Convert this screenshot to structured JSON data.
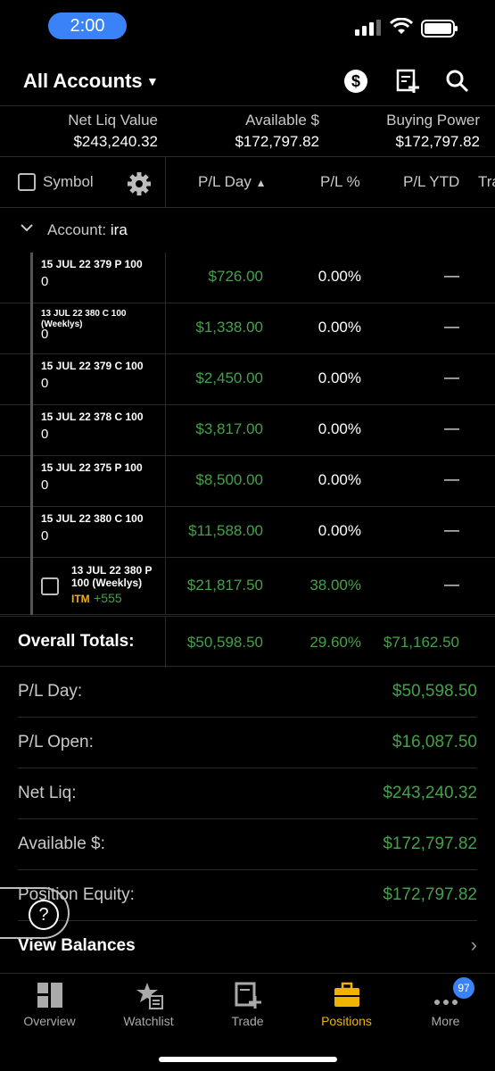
{
  "status_bar": {
    "time": "2:00"
  },
  "header": {
    "title": "All Accounts"
  },
  "summary": [
    {
      "label": "Net Liq Value",
      "value": "$243,240.32"
    },
    {
      "label": "Available $",
      "value": "$172,797.82"
    },
    {
      "label": "Buying Power",
      "value": "$172,797.82"
    }
  ],
  "columns": {
    "symbol": "Symbol",
    "pl_day": "P/L Day",
    "pl_pct": "P/L %",
    "pl_ytd": "P/L YTD",
    "trade_cut": "Tra"
  },
  "account_group": {
    "label": "Account:",
    "name": "ira"
  },
  "rows": [
    {
      "symbol": "15 JUL 22 379 P 100",
      "qty": "0",
      "pl_day": "$726.00",
      "pl_pct": "0.00%",
      "pl_ytd": "—"
    },
    {
      "symbol": "13 JUL 22 380 C 100 (Weeklys)",
      "qty": "0",
      "pl_day": "$1,338.00",
      "pl_pct": "0.00%",
      "pl_ytd": "—"
    },
    {
      "symbol": "15 JUL 22 379 C 100",
      "qty": "0",
      "pl_day": "$2,450.00",
      "pl_pct": "0.00%",
      "pl_ytd": "—"
    },
    {
      "symbol": "15 JUL 22 378 C 100",
      "qty": "0",
      "pl_day": "$3,817.00",
      "pl_pct": "0.00%",
      "pl_ytd": "—"
    },
    {
      "symbol": "15 JUL 22 375 P 100",
      "qty": "0",
      "pl_day": "$8,500.00",
      "pl_pct": "0.00%",
      "pl_ytd": "—"
    },
    {
      "symbol": "15 JUL 22 380 C 100",
      "qty": "0",
      "pl_day": "$11,588.00",
      "pl_pct": "0.00%",
      "pl_ytd": "—"
    },
    {
      "symbol": "13 JUL 22 380 P 100 (Weeklys)",
      "itm": "ITM",
      "change": "+555",
      "pl_day": "$21,817.50",
      "pl_pct": "38.00%",
      "pl_ytd": "—"
    }
  ],
  "totals": {
    "label": "Overall Totals:",
    "pl_day": "$50,598.50",
    "pl_pct": "29.60%",
    "pl_ytd": "$71,162.50"
  },
  "balances": [
    {
      "label": "P/L Day:",
      "value": "$50,598.50"
    },
    {
      "label": "P/L Open:",
      "value": "$16,087.50"
    },
    {
      "label": "Net Liq:",
      "value": "$243,240.32"
    },
    {
      "label": "Available $:",
      "value": "$172,797.82"
    },
    {
      "label": "Position Equity:",
      "value": "$172,797.82"
    }
  ],
  "view_balances": "View Balances",
  "help_icon": "?",
  "tabs": [
    {
      "label": "Overview",
      "icon": "overview-icon"
    },
    {
      "label": "Watchlist",
      "icon": "watchlist-icon"
    },
    {
      "label": "Trade",
      "icon": "trade-icon"
    },
    {
      "label": "Positions",
      "icon": "positions-icon",
      "active": true
    },
    {
      "label": "More",
      "icon": "more-icon",
      "badge": "97"
    }
  ],
  "colors": {
    "green": "#45a149",
    "accent": "#f0b400",
    "blue": "#3a82f7"
  }
}
